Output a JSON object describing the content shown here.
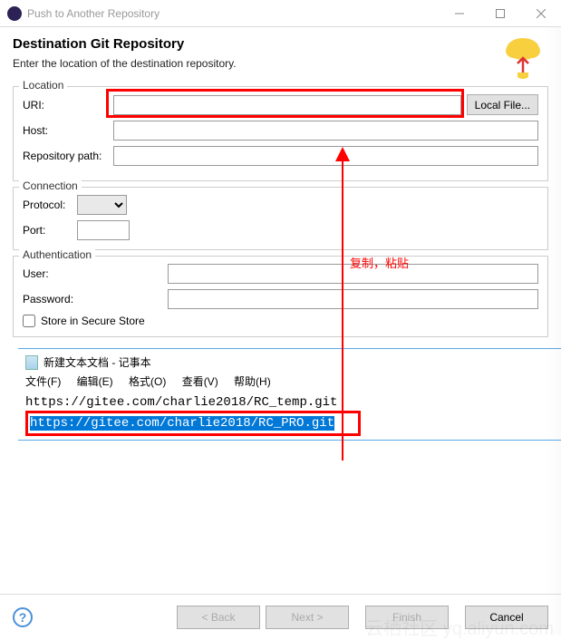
{
  "window": {
    "title": "Push to Another Repository"
  },
  "header": {
    "title": "Destination Git Repository",
    "desc": "Enter the location of the destination repository."
  },
  "location": {
    "legend": "Location",
    "uri_label": "URI:",
    "uri_value": "",
    "local_file_btn": "Local File...",
    "host_label": "Host:",
    "host_value": "",
    "repo_label": "Repository path:",
    "repo_value": ""
  },
  "connection": {
    "legend": "Connection",
    "protocol_label": "Protocol:",
    "protocol_value": "",
    "port_label": "Port:",
    "port_value": ""
  },
  "auth": {
    "legend": "Authentication",
    "user_label": "User:",
    "user_value": "",
    "password_label": "Password:",
    "password_value": "",
    "store_label": "Store in Secure Store"
  },
  "notepad": {
    "title": "新建文本文档 - 记事本",
    "menu_file": "文件(F)",
    "menu_edit": "编辑(E)",
    "menu_format": "格式(O)",
    "menu_view": "查看(V)",
    "menu_help": "帮助(H)",
    "line1": "https://gitee.com/charlie2018/RC_temp.git",
    "line2": "https://gitee.com/charlie2018/RC_PRO.git"
  },
  "annotation": {
    "text": "复制，粘贴"
  },
  "footer": {
    "back": "< Back",
    "next": "Next >",
    "finish": "Finish",
    "cancel": "Cancel"
  },
  "watermark": "云栖社区 yq.aliyun.com"
}
